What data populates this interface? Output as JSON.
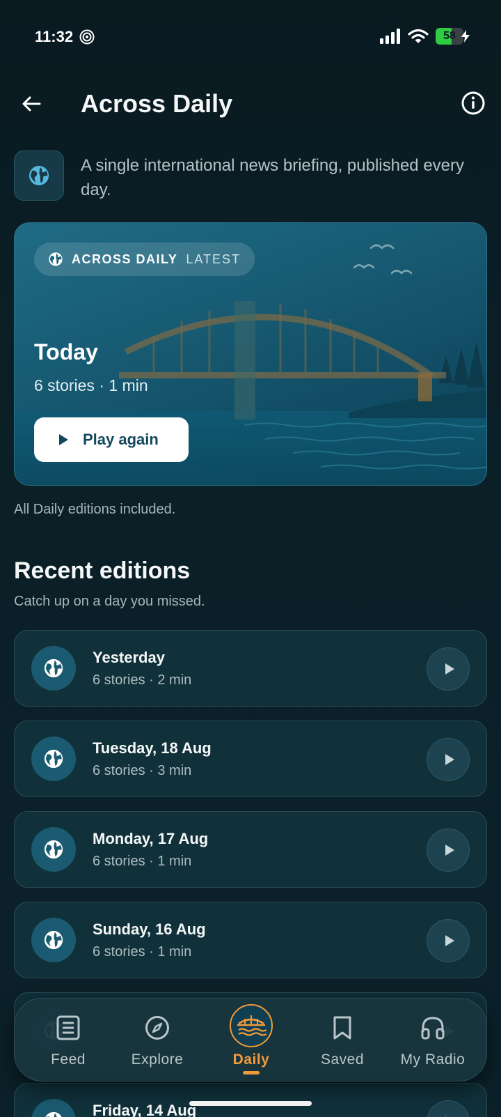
{
  "status_bar": {
    "time": "11:32",
    "battery": "58",
    "battery_level": 0.58,
    "charging": true,
    "icons": [
      "cast-icon",
      "signal-icon",
      "wifi-icon",
      "battery-icon",
      "charging-bolt-icon"
    ]
  },
  "header": {
    "title": "Across Daily",
    "back_icon": "arrow-left-icon",
    "info_icon": "info-icon"
  },
  "intro": {
    "icon": "globe-icon",
    "text": "A single international news briefing, published every day."
  },
  "hero": {
    "brand": "ACROSS DAILY",
    "tag": "LATEST",
    "title": "Today",
    "meta": "6 stories · 1 min",
    "button_label": "Play again",
    "button_icon": "play-icon"
  },
  "included_note": "All Daily editions included.",
  "recent": {
    "title": "Recent editions",
    "subtitle": "Catch up on a day you missed.",
    "items": [
      {
        "title": "Yesterday",
        "meta": "6 stories · 2 min"
      },
      {
        "title": "Tuesday, 18 Aug",
        "meta": "6 stories · 3 min"
      },
      {
        "title": "Monday, 17 Aug",
        "meta": "6 stories · 1 min"
      },
      {
        "title": "Sunday, 16 Aug",
        "meta": "6 stories · 1 min"
      },
      {
        "title": "",
        "meta": ""
      },
      {
        "title": "Friday, 14 Aug",
        "meta": ""
      }
    ]
  },
  "tabbar": {
    "tabs": [
      {
        "label": "Feed",
        "icon": "feed-icon"
      },
      {
        "label": "Explore",
        "icon": "compass-icon"
      },
      {
        "label": "Daily",
        "icon": "daily-bridge-icon",
        "active": true
      },
      {
        "label": "Saved",
        "icon": "bookmark-icon"
      },
      {
        "label": "My Radio",
        "icon": "headphones-icon"
      }
    ]
  },
  "colors": {
    "accent": "#f29b3a",
    "background": "#0a1a21",
    "card": "#10303a",
    "hero": "#175a72"
  }
}
